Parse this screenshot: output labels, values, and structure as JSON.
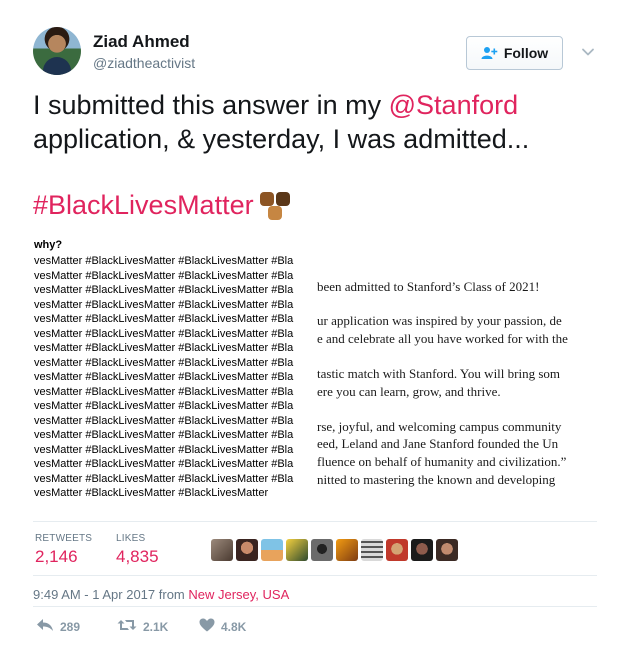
{
  "user": {
    "display_name": "Ziad Ahmed",
    "screen_name": "@ziadtheactivist"
  },
  "follow_button": {
    "label": "Follow"
  },
  "tweet": {
    "text_before": "I submitted this answer in my ",
    "mention": "@Stanford",
    "text_after": " application, & yesterday, I was admitted...",
    "hashtag": "#BlackLivesMatter"
  },
  "photo": {
    "question": "why?",
    "rows": [
      "vesMatter #BlackLivesMatter #BlackLivesMatter #Bla",
      "vesMatter #BlackLivesMatter #BlackLivesMatter #Bla",
      "vesMatter #BlackLivesMatter #BlackLivesMatter #Bla",
      "vesMatter #BlackLivesMatter #BlackLivesMatter #Bla",
      "vesMatter #BlackLivesMatter #BlackLivesMatter #Bla",
      "vesMatter #BlackLivesMatter #BlackLivesMatter #Bla",
      "vesMatter #BlackLivesMatter #BlackLivesMatter #Bla",
      "vesMatter #BlackLivesMatter #BlackLivesMatter #Bla",
      "vesMatter #BlackLivesMatter #BlackLivesMatter #Bla",
      "vesMatter #BlackLivesMatter #BlackLivesMatter #Bla",
      "vesMatter #BlackLivesMatter #BlackLivesMatter #Bla",
      "vesMatter #BlackLivesMatter #BlackLivesMatter #Bla",
      "vesMatter #BlackLivesMatter #BlackLivesMatter #Bla",
      "vesMatter #BlackLivesMatter #BlackLivesMatter #Bla",
      "vesMatter #BlackLivesMatter #BlackLivesMatter #Bla",
      "vesMatter #BlackLivesMatter #BlackLivesMatter #Bla",
      "vesMatter #BlackLivesMatter #BlackLivesMatter"
    ],
    "letter_lines": [
      "been admitted to Stanford’s Class of 2021!",
      "ur application was inspired by your passion, de",
      "e and celebrate all you have worked for with the",
      "tastic match with Stanford. You will bring som",
      "ere you can learn, grow, and thrive.",
      "rse, joyful, and welcoming campus community",
      "eed, Leland and Jane Stanford founded the Un",
      "fluence on behalf of humanity and civilization.”",
      "nitted to mastering the known and developing"
    ]
  },
  "stats": {
    "retweets_label": "RETWEETS",
    "retweets_value": "2,146",
    "likes_label": "LIKES",
    "likes_value": "4,835"
  },
  "meta": {
    "time": "9:49 AM - 1 Apr 2017 from ",
    "location": "New Jersey, USA"
  },
  "actions": {
    "reply_count": "289",
    "retweet_count": "2.1K",
    "like_count": "4.8K"
  },
  "colors": {
    "accent": "#e0245e",
    "secondary_text": "#657786",
    "icon_gray": "#8899a6"
  }
}
